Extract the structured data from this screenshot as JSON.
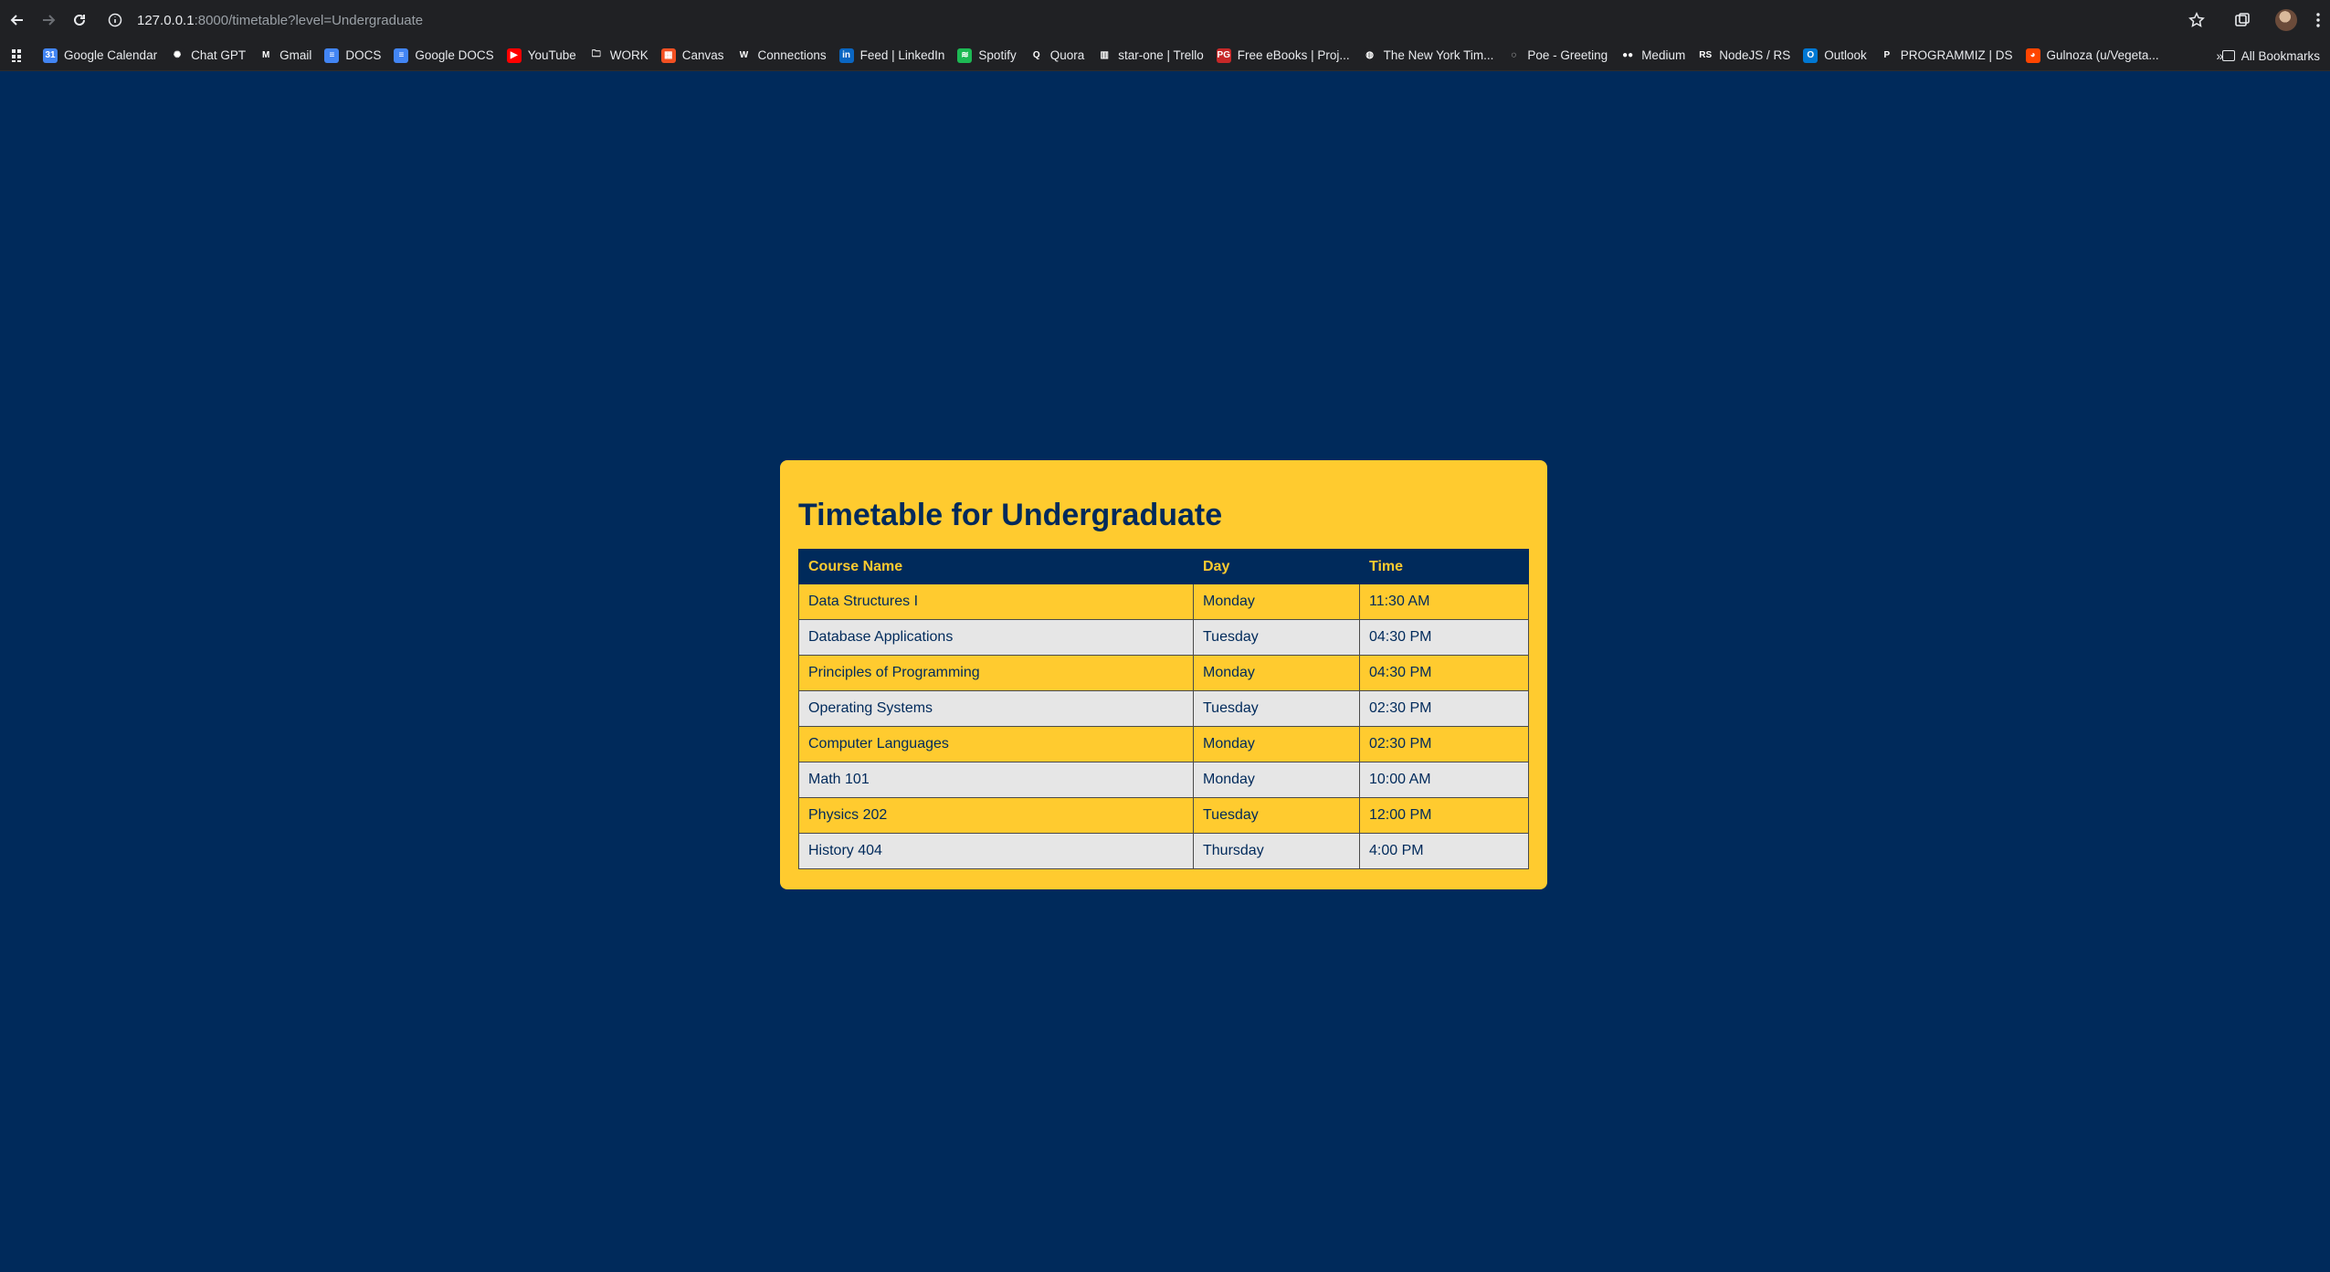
{
  "browser": {
    "url_host": "127.0.0.1",
    "url_rest": ":8000/timetable?level=Undergraduate"
  },
  "bookmarks": [
    {
      "label": "Google Calendar",
      "icon": "calendar-icon",
      "color": "#4285f4",
      "glyph": "31"
    },
    {
      "label": "Chat GPT",
      "icon": "openai-icon",
      "color": "#202124",
      "glyph": "✺"
    },
    {
      "label": "Gmail",
      "icon": "gmail-icon",
      "color": "#202124",
      "glyph": "M"
    },
    {
      "label": "DOCS",
      "icon": "docs-icon",
      "color": "#4285f4",
      "glyph": "≡"
    },
    {
      "label": "Google DOCS",
      "icon": "docs-icon",
      "color": "#4285f4",
      "glyph": "≡"
    },
    {
      "label": "YouTube",
      "icon": "youtube-icon",
      "color": "#ff0000",
      "glyph": "▶"
    },
    {
      "label": "WORK",
      "icon": "folder-icon",
      "color": "#202124",
      "glyph": "🗀"
    },
    {
      "label": "Canvas",
      "icon": "canvas-icon",
      "color": "#f25022",
      "glyph": "▦"
    },
    {
      "label": "Connections",
      "icon": "connections-icon",
      "color": "#202124",
      "glyph": "W"
    },
    {
      "label": "Feed | LinkedIn",
      "icon": "linkedin-icon",
      "color": "#0a66c2",
      "glyph": "in"
    },
    {
      "label": "Spotify",
      "icon": "spotify-icon",
      "color": "#1db954",
      "glyph": "≋"
    },
    {
      "label": "Quora",
      "icon": "quora-icon",
      "color": "#202124",
      "glyph": "Q"
    },
    {
      "label": "star-one | Trello",
      "icon": "trello-icon",
      "color": "#202124",
      "glyph": "▥"
    },
    {
      "label": "Free eBooks | Proj...",
      "icon": "ebook-icon",
      "color": "#c62828",
      "glyph": "PG"
    },
    {
      "label": "The New York Tim...",
      "icon": "globe-icon",
      "color": "#202124",
      "glyph": "◍"
    },
    {
      "label": "Poe - Greeting",
      "icon": "poe-icon",
      "color": "#202124",
      "glyph": "◌"
    },
    {
      "label": "Medium",
      "icon": "medium-icon",
      "color": "#202124",
      "glyph": "●●"
    },
    {
      "label": "NodeJS / RS",
      "icon": "rs-icon",
      "color": "#202124",
      "glyph": "RS"
    },
    {
      "label": "Outlook",
      "icon": "outlook-icon",
      "color": "#0078d4",
      "glyph": "O"
    },
    {
      "label": "PROGRAMMIZ | DS",
      "icon": "programiz-icon",
      "color": "#202124",
      "glyph": "P"
    },
    {
      "label": "Gulnoza (u/Vegeta...",
      "icon": "reddit-icon",
      "color": "#ff4500",
      "glyph": "◕"
    }
  ],
  "all_bookmarks_label": "All Bookmarks",
  "page": {
    "title": "Timetable for Undergraduate",
    "columns": [
      "Course Name",
      "Day",
      "Time"
    ],
    "rows": [
      [
        "Data Structures I",
        "Monday",
        "11:30 AM"
      ],
      [
        "Database Applications",
        "Tuesday",
        "04:30 PM"
      ],
      [
        "Principles of Programming",
        "Monday",
        "04:30 PM"
      ],
      [
        "Operating Systems",
        "Tuesday",
        "02:30 PM"
      ],
      [
        "Computer Languages",
        "Monday",
        "02:30 PM"
      ],
      [
        "Math 101",
        "Monday",
        "10:00 AM"
      ],
      [
        "Physics 202",
        "Tuesday",
        "12:00 PM"
      ],
      [
        "History 404",
        "Thursday",
        "4:00 PM"
      ]
    ]
  },
  "colors": {
    "page_bg": "#002a5b",
    "card_bg": "#ffcb2f",
    "row_alt_bg": "#e6e6e6",
    "header_text": "#ffcb2f"
  }
}
